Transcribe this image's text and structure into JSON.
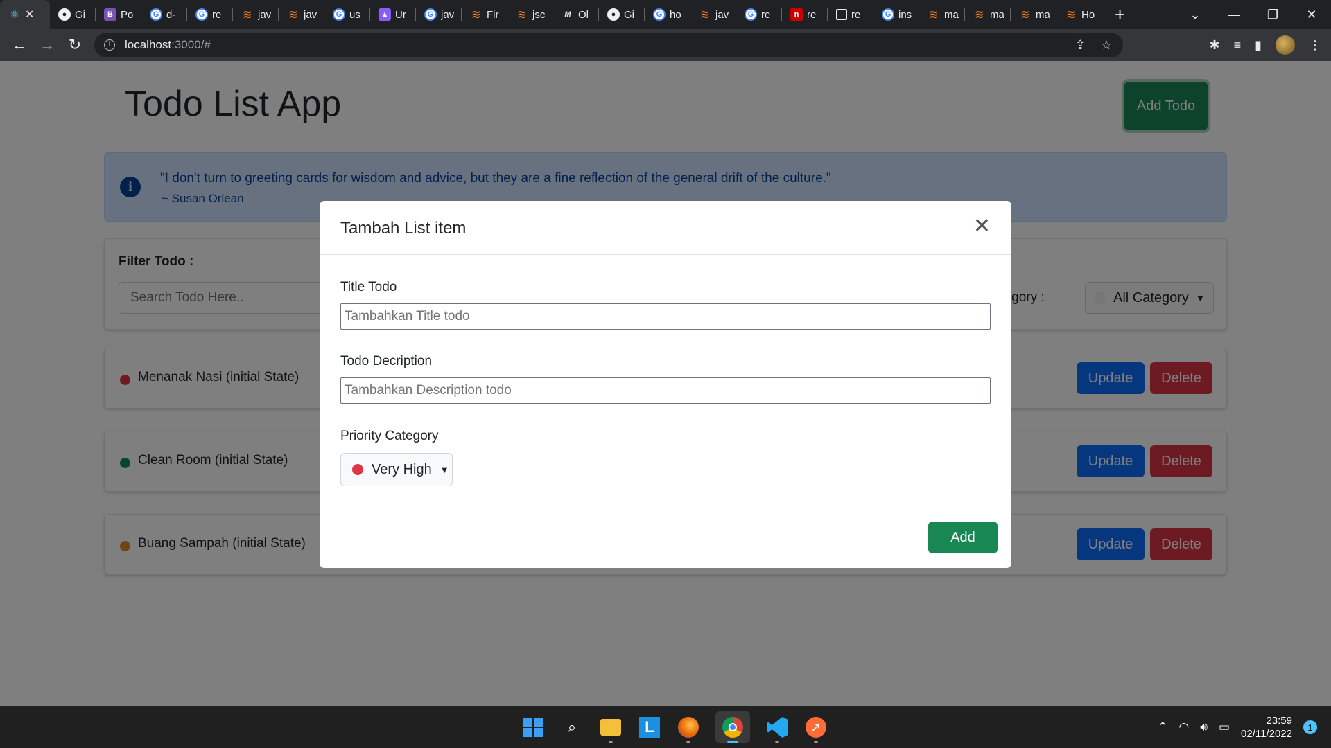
{
  "browser": {
    "tabs": [
      {
        "icon": "react-icon",
        "label": "",
        "active": true
      },
      {
        "icon": "github-icon",
        "label": "Gi"
      },
      {
        "icon": "bootstrap-icon",
        "label": "Po"
      },
      {
        "icon": "google-icon",
        "label": "d-"
      },
      {
        "icon": "google-icon",
        "label": "re"
      },
      {
        "icon": "stackoverflow-icon",
        "label": "jav"
      },
      {
        "icon": "stackoverflow-icon",
        "label": "jav"
      },
      {
        "icon": "google-icon",
        "label": "us"
      },
      {
        "icon": "app-icon",
        "label": "Ur"
      },
      {
        "icon": "google-icon",
        "label": "jav"
      },
      {
        "icon": "stackoverflow-icon",
        "label": "Fir"
      },
      {
        "icon": "stackoverflow-icon",
        "label": "jsc"
      },
      {
        "icon": "medium-icon",
        "label": "Ol"
      },
      {
        "icon": "github-icon",
        "label": "Gi"
      },
      {
        "icon": "google-icon",
        "label": "ho"
      },
      {
        "icon": "stackoverflow-icon",
        "label": "jav"
      },
      {
        "icon": "google-icon",
        "label": "re"
      },
      {
        "icon": "npm-icon",
        "label": "re"
      },
      {
        "icon": "page-icon",
        "label": "re"
      },
      {
        "icon": "google-icon",
        "label": "ins"
      },
      {
        "icon": "stackoverflow-icon",
        "label": "ma"
      },
      {
        "icon": "stackoverflow-icon",
        "label": "ma"
      },
      {
        "icon": "stackoverflow-icon",
        "label": "ma"
      },
      {
        "icon": "stackoverflow-icon",
        "label": "Ho"
      }
    ],
    "url_host": "localhost",
    "url_path": ":3000/#"
  },
  "app": {
    "title": "Todo List App",
    "add_todo_label": "Add Todo",
    "quote_text": "\"I don't turn to greeting cards for wisdom and advice, but they are a fine reflection of the general drift of the culture.\"",
    "quote_author": "~ Susan Orlean",
    "filter": {
      "title": "Filter Todo :",
      "search_placeholder": "Search Todo Here..",
      "category_label": "Category :",
      "category_value": "All Category"
    },
    "todos": [
      {
        "name": "Menanak Nasi (initial State)",
        "color": "#dc3545",
        "done": true
      },
      {
        "name": "Clean Room (initial State)",
        "color": "#0f8a6a",
        "done": false
      },
      {
        "name": "Buang Sampah (initial State)",
        "color": "#e08f24",
        "done": false
      }
    ],
    "update_label": "Update",
    "delete_label": "Delete"
  },
  "modal": {
    "title": "Tambah List item",
    "title_label": "Title Todo",
    "title_placeholder": "Tambahkan Title todo",
    "desc_label": "Todo Decription",
    "desc_placeholder": "Tambahkan Description todo",
    "priority_label": "Priority Category",
    "priority_value": "Very High",
    "priority_color": "#dc3545",
    "add_label": "Add"
  },
  "taskbar": {
    "apps": [
      "start-icon",
      "search-icon",
      "file-explorer-icon",
      "l-app-icon",
      "firefox-icon",
      "chrome-icon",
      "vscode-icon",
      "postman-icon"
    ],
    "time": "23:59",
    "date": "02/11/2022",
    "notification_count": "1"
  }
}
